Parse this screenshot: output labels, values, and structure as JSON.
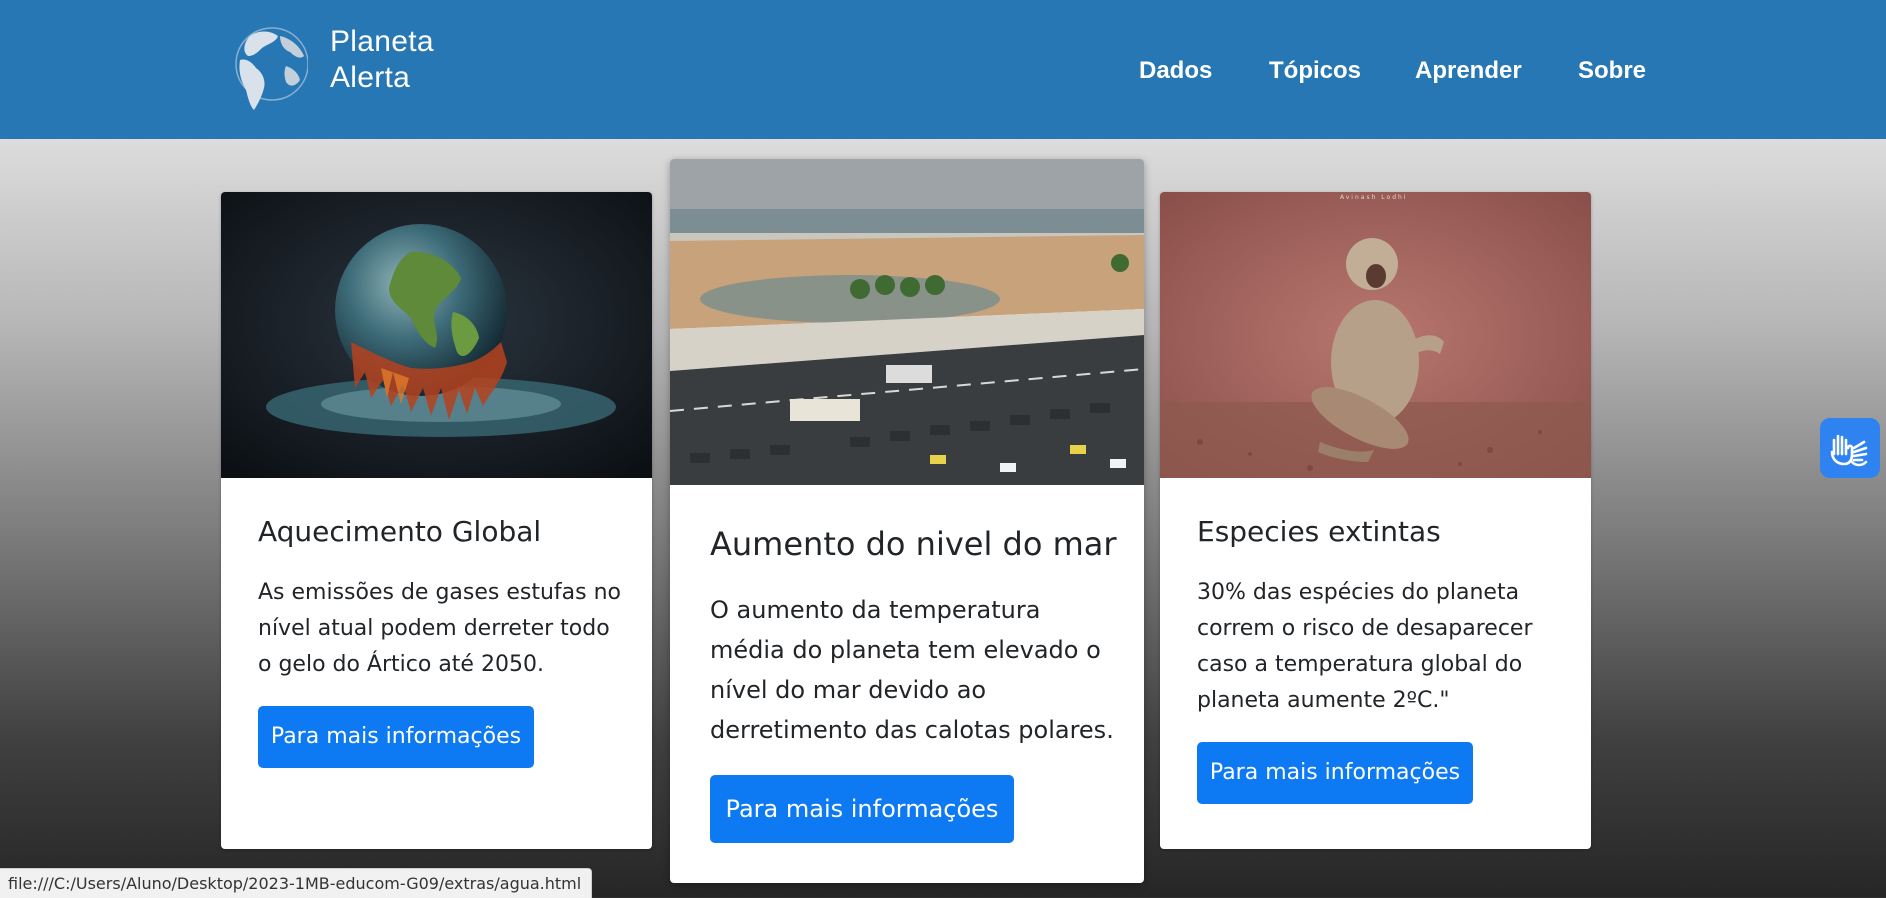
{
  "header": {
    "brand_line1": "Planeta",
    "brand_line2": "Alerta",
    "logo_icon": "globe-icon",
    "nav": [
      "Dados",
      "Tópicos",
      "Aprender",
      "Sobre"
    ]
  },
  "cards": [
    {
      "image_icon": "melting-earth-image",
      "title": "Aquecimento Global",
      "text": [
        "As emissões de gases estufas no",
        "nível atual podem derreter todo",
        "o gelo do Ártico até 2050."
      ],
      "button": "Para mais informações"
    },
    {
      "image_icon": "flooded-beach-image",
      "title": "Aumento do nivel do mar",
      "text": [
        "O aumento da temperatura",
        "média do planeta tem elevado o",
        "nível do mar devido ao",
        "derretimento das calotas polares."
      ],
      "button": "Para mais informações"
    },
    {
      "image_icon": "monkeys-image",
      "watermark": "Avinash Lodhi",
      "title": "Especies extintas",
      "text": [
        "30% das espécies do planeta",
        "correm o risco de desaparecer",
        "caso a temperatura global do",
        "planeta aumente 2ºC.\""
      ],
      "button": "Para mais informações"
    }
  ],
  "accessibility": {
    "icon": "sign-language-hands-icon"
  },
  "status_bar": {
    "url": "file:///C:/Users/Aluno/Desktop/2023-1MB-educom-G09/extras/agua.html"
  },
  "colors": {
    "navbar": "#2677b3",
    "button": "#0d79f2",
    "accessibility_button": "#2f83f0",
    "card": "#ffffff"
  }
}
